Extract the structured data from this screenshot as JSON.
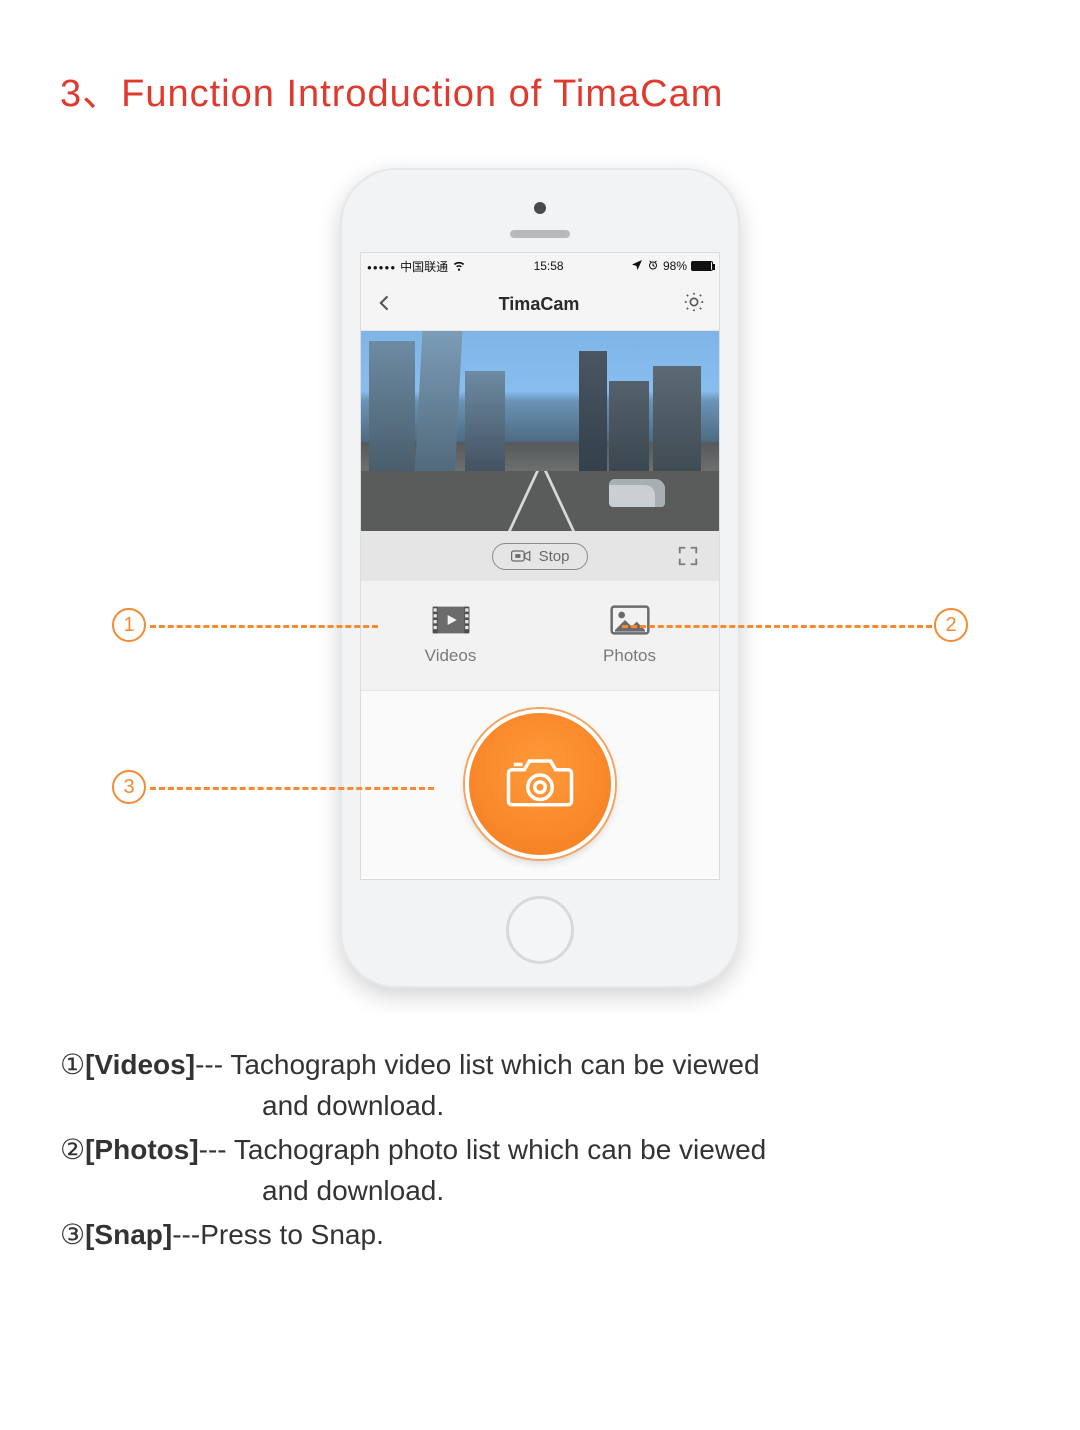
{
  "page": {
    "title": "3、Function Introduction of TimaCam"
  },
  "status": {
    "carrier": "中国联通",
    "time": "15:58",
    "battery_pct": "98%"
  },
  "nav": {
    "title": "TimaCam"
  },
  "controls": {
    "stop_label": "Stop"
  },
  "gallery": {
    "videos_label": "Videos",
    "photos_label": "Photos"
  },
  "callouts": {
    "n1": "1",
    "n2": "2",
    "n3": "3"
  },
  "legend": {
    "item1_num": "①",
    "item1_key": "[Videos]",
    "item1_sep": "--- ",
    "item1_desc": "Tachograph video list which can be viewed",
    "item1_cont": "and download.",
    "item2_num": "②",
    "item2_key": "[Photos]",
    "item2_sep": "--- ",
    "item2_desc": "Tachograph photo list which can be viewed",
    "item2_cont": "and download.",
    "item3_num": "③",
    "item3_key": "[Snap]",
    "item3_sep": "---",
    "item3_desc": "Press to Snap."
  }
}
